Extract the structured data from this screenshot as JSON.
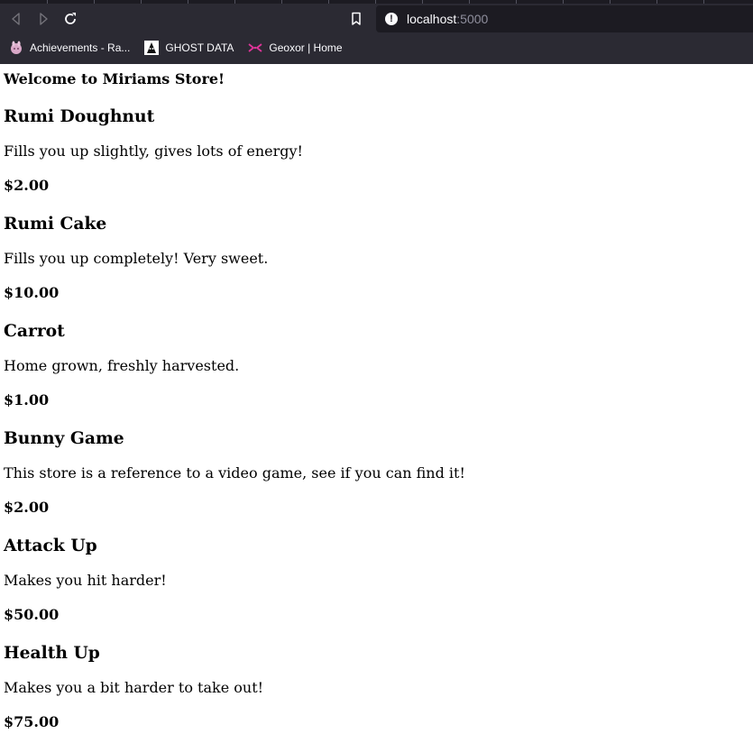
{
  "browser": {
    "url_host": "localhost",
    "url_port": ":5000",
    "bookmarks": [
      {
        "label": "Achievements - Ra..."
      },
      {
        "label": "GHOST DATA"
      },
      {
        "label": "Geoxor | Home"
      }
    ]
  },
  "page": {
    "welcome": "Welcome to Miriams Store!",
    "items": [
      {
        "name": "Rumi Doughnut",
        "description": "Fills you up slightly, gives lots of energy!",
        "price": "$2.00"
      },
      {
        "name": "Rumi Cake",
        "description": "Fills you up completely! Very sweet.",
        "price": "$10.00"
      },
      {
        "name": "Carrot",
        "description": "Home grown, freshly harvested.",
        "price": "$1.00"
      },
      {
        "name": "Bunny Game",
        "description": "This store is a reference to a video game, see if you can find it!",
        "price": "$2.00"
      },
      {
        "name": "Attack Up",
        "description": "Makes you hit harder!",
        "price": "$50.00"
      },
      {
        "name": "Health Up",
        "description": "Makes you a bit harder to take out!",
        "price": "$75.00"
      }
    ]
  }
}
